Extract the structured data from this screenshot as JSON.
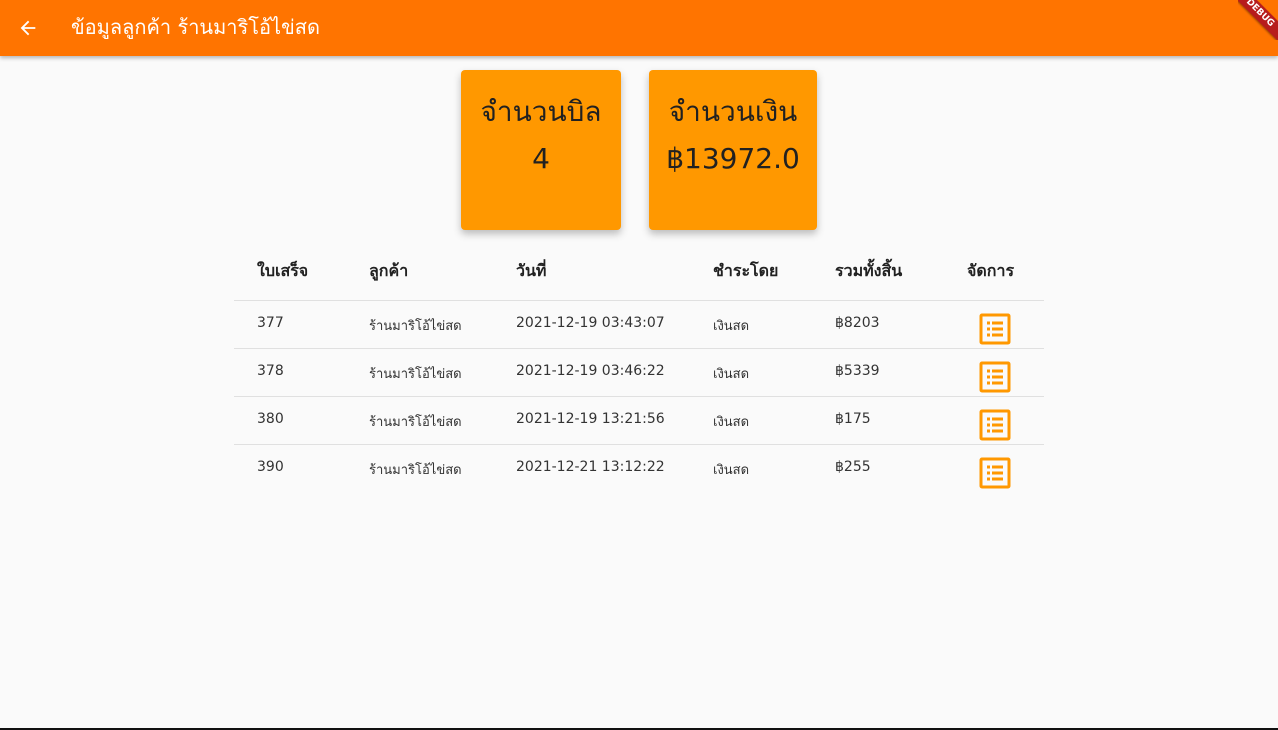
{
  "appbar": {
    "title": "ข้อมูลลูกค้า ร้านมาริโอ้ไข่สด",
    "back_icon": "arrow-back-icon",
    "background": "#ff7400",
    "debug_banner": "DEBUG"
  },
  "summary": {
    "bills_label": "จำนวนบิล",
    "bills_value": "4",
    "money_label": "จำนวนเงิน",
    "money_value": "฿13972.0",
    "card_color": "#ff9800"
  },
  "table": {
    "headers": [
      "ใบเสร็จ",
      "ลูกค้า",
      "วันที่",
      "ชำระโดย",
      "รวมทั้งสิ้น",
      "จัดการ"
    ],
    "rows": [
      {
        "receipt": "377",
        "customer": "ร้านมาริโอ้ไข่สด",
        "date": "2021-12-19 03:43:07",
        "payment": "เงินสด",
        "total": "฿8203",
        "action_icon": "list-alt-icon"
      },
      {
        "receipt": "378",
        "customer": "ร้านมาริโอ้ไข่สด",
        "date": "2021-12-19 03:46:22",
        "payment": "เงินสด",
        "total": "฿5339",
        "action_icon": "list-alt-icon"
      },
      {
        "receipt": "380",
        "customer": "ร้านมาริโอ้ไข่สด",
        "date": "2021-12-19 13:21:56",
        "payment": "เงินสด",
        "total": "฿175",
        "action_icon": "list-alt-icon"
      },
      {
        "receipt": "390",
        "customer": "ร้านมาริโอ้ไข่สด",
        "date": "2021-12-21 13:12:22",
        "payment": "เงินสด",
        "total": "฿255",
        "action_icon": "list-alt-icon"
      }
    ],
    "icon_color": "#ff9800"
  }
}
